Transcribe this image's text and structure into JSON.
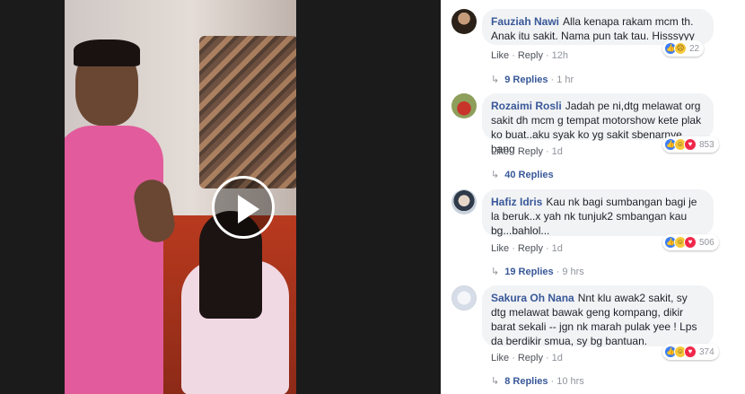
{
  "video": {
    "play_icon": "play-circle-icon"
  },
  "comments": [
    {
      "author": "Fauziah Nawi",
      "text": "Alla kenapa rakam mcm th. Anak itu sakit. Nama pun tak tau. Hisssyyy",
      "like": "Like",
      "reply": "Reply",
      "time": "12h",
      "reaction_count": "22",
      "reactions": [
        "like",
        "sad"
      ],
      "replies_label": "9 Replies",
      "replies_time": "1 hr"
    },
    {
      "author": "Rozaimi Rosli",
      "text": "Jadah pe ni,dtg melawat org sakit dh mcm g tempat motorshow kete plak ko buat..aku syak ko yg sakit sbenarnye bang",
      "like": "Like",
      "reply": "Reply",
      "time": "1d",
      "reaction_count": "853",
      "reactions": [
        "like",
        "haha",
        "love"
      ],
      "replies_label": "40 Replies",
      "replies_time": ""
    },
    {
      "author": "Hafiz Idris",
      "text": "Kau nk bagi sumbangan bagi je la beruk..x yah nk tunjuk2 smbangan kau bg...bahlol...",
      "like": "Like",
      "reply": "Reply",
      "time": "1d",
      "reaction_count": "506",
      "reactions": [
        "like",
        "haha",
        "love"
      ],
      "replies_label": "19 Replies",
      "replies_time": "9 hrs"
    },
    {
      "author": "Sakura Oh Nana",
      "text": "Nnt klu awak2 sakit, sy dtg melawat bawak geng kompang, dikir barat sekali -- jgn nk marah pulak yee ! Lps da berdikir smua, sy bg bantuan.",
      "like": "Like",
      "reply": "Reply",
      "time": "1d",
      "reaction_count": "374",
      "reactions": [
        "like",
        "haha",
        "love"
      ],
      "replies_label": "8 Replies",
      "replies_time": "10 hrs"
    }
  ],
  "colors": {
    "author": "#385898",
    "bubble": "#f2f3f5",
    "like": "#3b7df2",
    "love": "#f0284a",
    "haha": "#f7c93b"
  }
}
